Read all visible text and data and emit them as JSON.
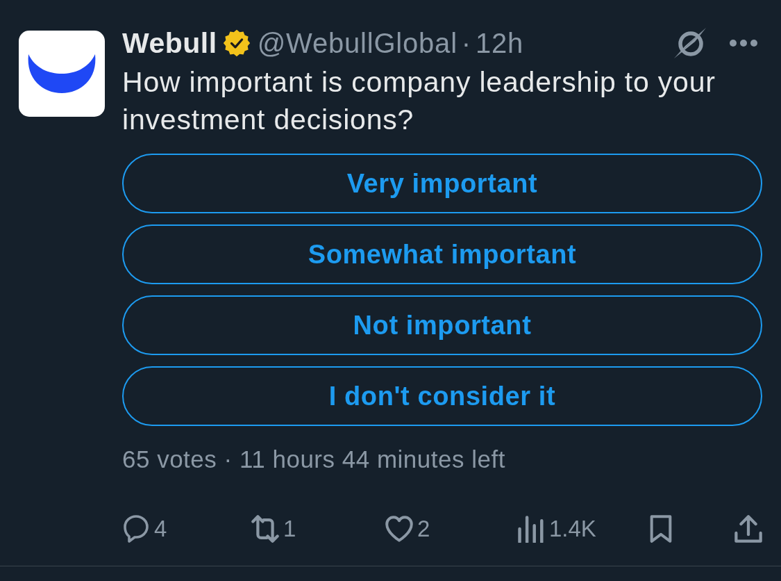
{
  "post": {
    "author": {
      "name": "Webull",
      "verified": true,
      "handle": "@WebullGlobal",
      "separator": "·",
      "time": "12h"
    },
    "text": "How important is company leadership to your investment decisions?",
    "poll": {
      "options": [
        {
          "label": "Very important"
        },
        {
          "label": "Somewhat important"
        },
        {
          "label": "Not important"
        },
        {
          "label": "I don't consider it"
        }
      ],
      "summary": "65 votes · 11 hours 44 minutes left"
    },
    "actions": [
      {
        "kind": "reply",
        "count": "4"
      },
      {
        "kind": "repost",
        "count": "1"
      },
      {
        "kind": "like",
        "count": "2"
      },
      {
        "kind": "views",
        "count": "1.4K"
      },
      {
        "kind": "bookmark"
      },
      {
        "kind": "share"
      }
    ]
  }
}
